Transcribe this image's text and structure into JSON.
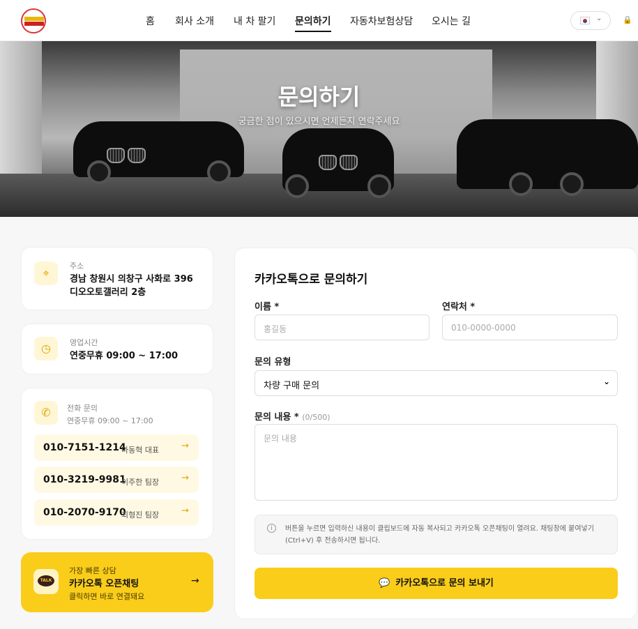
{
  "nav": {
    "items": [
      "홈",
      "회사 소개",
      "내 차 팔기",
      "문의하기",
      "자동차보험상담",
      "오시는 길"
    ],
    "active": "문의하기"
  },
  "hero": {
    "title": "문의하기",
    "subtitle": "궁금한 점이 있으시면 언제든지 연락주세요"
  },
  "address": {
    "label": "주소",
    "line1": "경남 창원시 의창구 사화로 396",
    "line2": "디오오토갤러리 2층"
  },
  "hours": {
    "label": "영업시간",
    "value": "연중무휴 09:00 ~ 17:00"
  },
  "phone": {
    "label": "전화 문의",
    "sub": "연중무휴 09:00 ~ 17:00",
    "contacts": [
      {
        "number": "010-7151-1214",
        "name": "마동혁 대표"
      },
      {
        "number": "010-3219-9981",
        "name": "이주한 팀장"
      },
      {
        "number": "010-2070-9170",
        "name": "최형진 팀장"
      }
    ]
  },
  "kakao_card": {
    "eyebrow": "가장 빠른 상담",
    "title": "카카오톡 오픈채팅",
    "sub": "클릭하면 바로 연결돼요",
    "badge": "TALK"
  },
  "form": {
    "title": "카카오톡으로 문의하기",
    "name_label": "이름",
    "name_placeholder": "홍길동",
    "contact_label": "연락처",
    "contact_placeholder": "010-0000-0000",
    "type_label": "문의 유형",
    "type_value": "차량 구매 문의",
    "content_label": "문의 내용",
    "content_count": "(0/500)",
    "content_placeholder": "문의 내용",
    "required_mark": "*",
    "info": "버튼을 누르면 입력하신 내용이 클립보드에 자동 복사되고 카카오톡 오픈채팅이 열려요. 채팅창에 붙여넣기(Ctrl+V) 후 전송하시면 됩니다.",
    "submit": "카카오톡으로 문의 보내기"
  },
  "colors": {
    "accent": "#facd1a",
    "accent_soft": "#fff9e3",
    "icon": "#e0a400"
  },
  "icons": {
    "address": "map-pin-icon",
    "hours": "clock-icon",
    "phone": "phone-icon",
    "arrow": "arrow-right-icon",
    "info": "info-icon",
    "chat": "chat-bubble-icon"
  }
}
